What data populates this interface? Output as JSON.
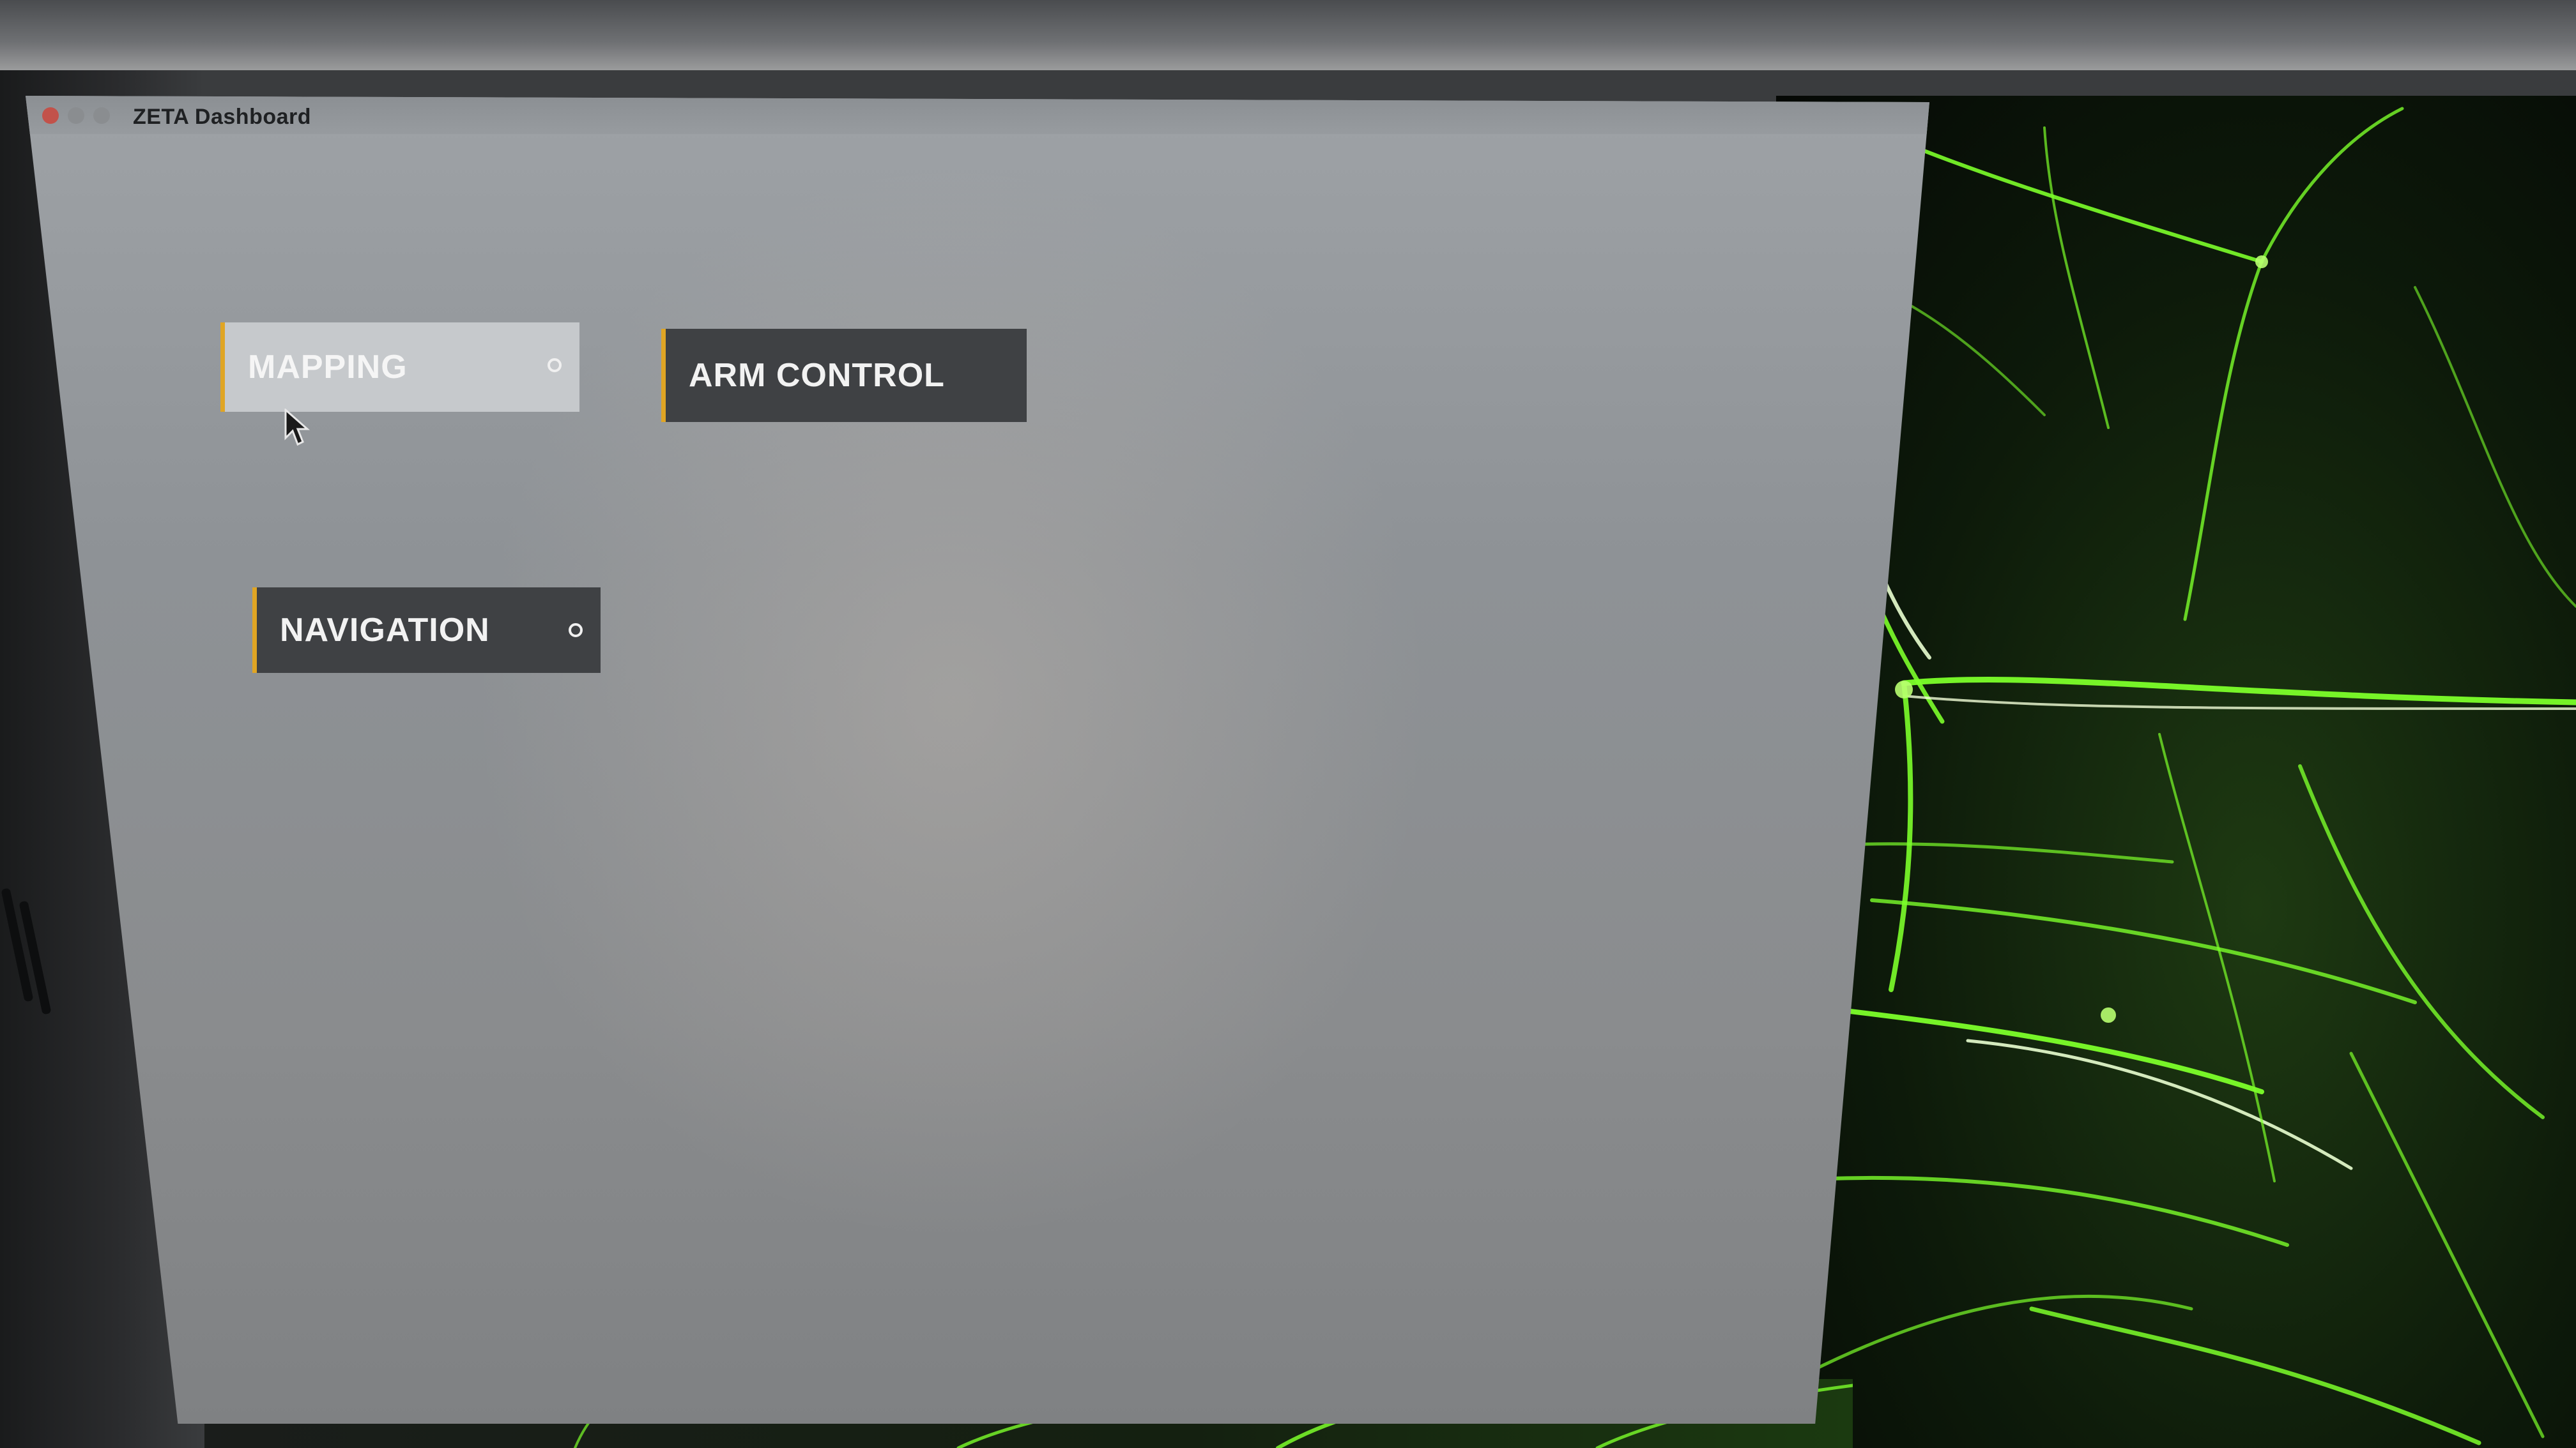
{
  "window": {
    "title": "ZETA Dashboard"
  },
  "modules": {
    "mapping": {
      "label": "MAPPING",
      "active": true
    },
    "arm_control": {
      "label": "ARM CONTROL",
      "active": false
    },
    "navigation": {
      "label": "NAVIGATION",
      "active": false
    }
  },
  "colors": {
    "accent": "#e0a524",
    "button_bg": "#3f4144",
    "button_active_bg": "#c6c9cc",
    "window_bg": "#8e9296",
    "wallpaper_glow": "#7cff2a"
  },
  "icons": {
    "window_close": "traffic-close-icon",
    "window_minimize": "traffic-minimize-icon",
    "window_maximize": "traffic-maximize-icon",
    "module_indicator": "radio-dot-icon",
    "pointer": "mouse-pointer-icon"
  }
}
